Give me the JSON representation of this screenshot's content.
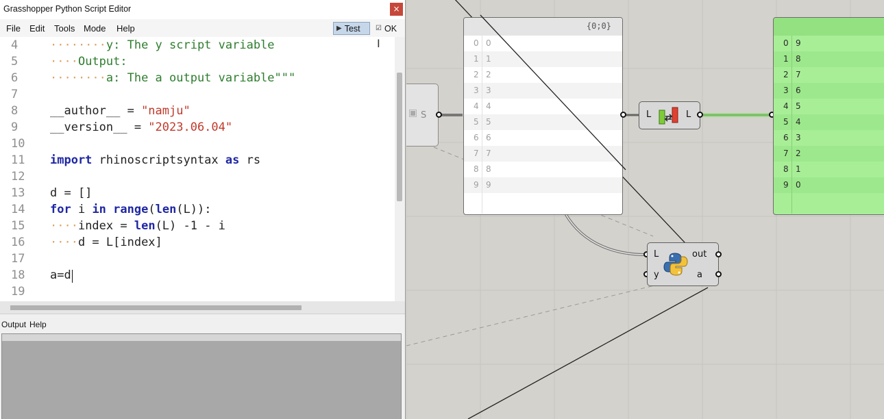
{
  "window": {
    "title": "Grasshopper Python Script Editor",
    "close_label": "×"
  },
  "menu": {
    "file": "File",
    "edit": "Edit",
    "tools": "Tools",
    "mode": "Mode",
    "help": "Help"
  },
  "toolbar": {
    "test_label": "Test",
    "ok_label": "OK"
  },
  "code": {
    "line_numbers": [
      "4",
      "5",
      "6",
      "7",
      "8",
      "9",
      "10",
      "11",
      "12",
      "13",
      "14",
      "15",
      "16",
      "17",
      "18",
      "19"
    ],
    "l4_text": "y: The y script variable",
    "l5_text": "Output:",
    "l6_text": "a: The a output variable\"\"\"",
    "l8_name": "__author__ = ",
    "l8_str": "\"namju\"",
    "l9_name": "__version__ = ",
    "l9_str": "\"2023.06.04\"",
    "l11_kw": "import",
    "l11_mod": " rhinoscriptsyntax ",
    "l11_as": "as",
    "l11_alias": " rs",
    "l13": "d = []",
    "l14_for": "for",
    "l14_i": " i ",
    "l14_in": "in",
    "l14_range": "range",
    "l14_p1": "(",
    "l14_len": "len",
    "l14_rest": "(L)):",
    "l15_pre": "index = ",
    "l15_len": "len",
    "l15_rest": "(L) -1 - i",
    "l16": "d = L[index]",
    "l18": "a=d"
  },
  "panel": {
    "output_tab": "Output",
    "help_tab": "Help"
  },
  "canvas": {
    "left_panel": {
      "path": "{0;0}",
      "rows": [
        [
          "0",
          "0"
        ],
        [
          "1",
          "1"
        ],
        [
          "2",
          "2"
        ],
        [
          "3",
          "3"
        ],
        [
          "4",
          "4"
        ],
        [
          "5",
          "5"
        ],
        [
          "6",
          "6"
        ],
        [
          "7",
          "7"
        ],
        [
          "8",
          "8"
        ],
        [
          "9",
          "9"
        ]
      ]
    },
    "right_panel": {
      "rows": [
        [
          "0",
          "9"
        ],
        [
          "1",
          "8"
        ],
        [
          "2",
          "7"
        ],
        [
          "3",
          "6"
        ],
        [
          "4",
          "5"
        ],
        [
          "5",
          "4"
        ],
        [
          "6",
          "3"
        ],
        [
          "7",
          "2"
        ],
        [
          "8",
          "1"
        ],
        [
          "9",
          "0"
        ]
      ]
    },
    "reverse_component": {
      "input": "L",
      "output": "L",
      "icon": "reverse-list-icon"
    },
    "python_component": {
      "in1": "L",
      "in2": "y",
      "out1": "out",
      "out2": "a",
      "icon": "python-icon"
    },
    "partial_node_label": "S"
  }
}
